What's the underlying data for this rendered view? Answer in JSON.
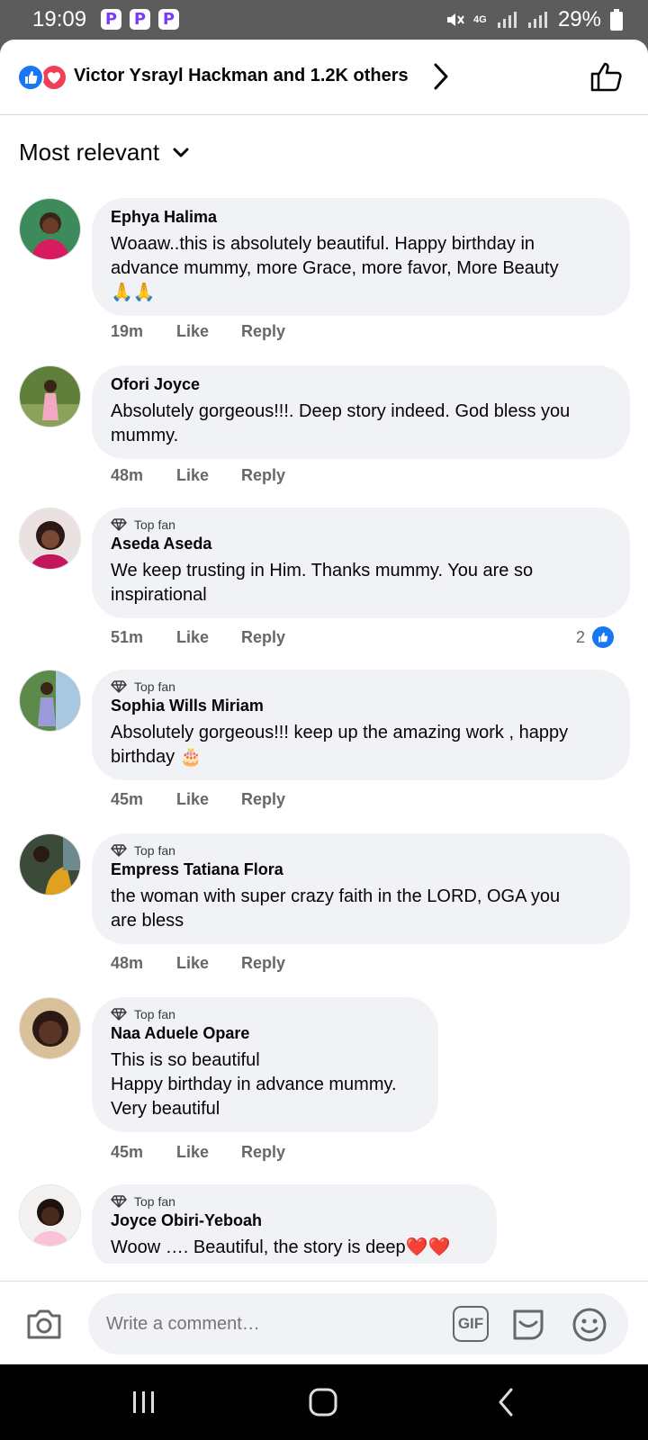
{
  "status": {
    "time": "19:09",
    "app_icons": [
      "P",
      "P",
      "P"
    ],
    "network": "4G",
    "battery": "29%"
  },
  "reactions": {
    "summary": "Victor Ysrayl Hackman and 1.2K others",
    "icons": [
      "like-reaction-icon",
      "love-reaction-icon"
    ]
  },
  "sort": {
    "label": "Most relevant"
  },
  "badge_label": "Top fan",
  "actions": {
    "like": "Like",
    "reply": "Reply"
  },
  "comments": [
    {
      "author": "Ephya Halima",
      "top_fan": false,
      "lines": [
        "Woaaw..this is absolutely beautiful. Happy birthday in",
        "advance mummy, more Grace, more favor, More Beauty",
        "🙏🙏"
      ],
      "age": "19m"
    },
    {
      "author": "Ofori Joyce",
      "top_fan": false,
      "lines": [
        "Absolutely gorgeous!!!. Deep story indeed. God bless you",
        "mummy."
      ],
      "age": "48m"
    },
    {
      "author": "Aseda Aseda",
      "top_fan": true,
      "lines": [
        "We  keep trusting in Him. Thanks mummy. You are so",
        "inspirational"
      ],
      "age": "51m",
      "reaction_count": "2"
    },
    {
      "author": "Sophia Wills Miriam",
      "top_fan": true,
      "lines": [
        "Absolutely gorgeous!!! keep up the amazing work , happy",
        "birthday 🎂"
      ],
      "age": "45m"
    },
    {
      "author": "Empress Tatiana Flora",
      "top_fan": true,
      "lines": [
        "the woman with super crazy faith in the LORD, OGA you",
        "are bless"
      ],
      "age": "48m"
    },
    {
      "author": "Naa Aduele Opare",
      "top_fan": true,
      "lines": [
        "This is so beautiful",
        "Happy birthday in advance mummy.",
        "Very beautiful"
      ],
      "age": "45m"
    },
    {
      "author": "Joyce Obiri-Yeboah",
      "top_fan": true,
      "lines": [
        "Woow …. Beautiful, the story is deep❤️❤️"
      ],
      "age": ""
    }
  ],
  "composer": {
    "placeholder": "Write a comment…",
    "gif_label": "GIF"
  },
  "colors": {
    "facebook_blue": "#1877f2",
    "love_red": "#f33e58",
    "bubble_bg": "#f0f2f5",
    "meta_grey": "#65676b"
  }
}
